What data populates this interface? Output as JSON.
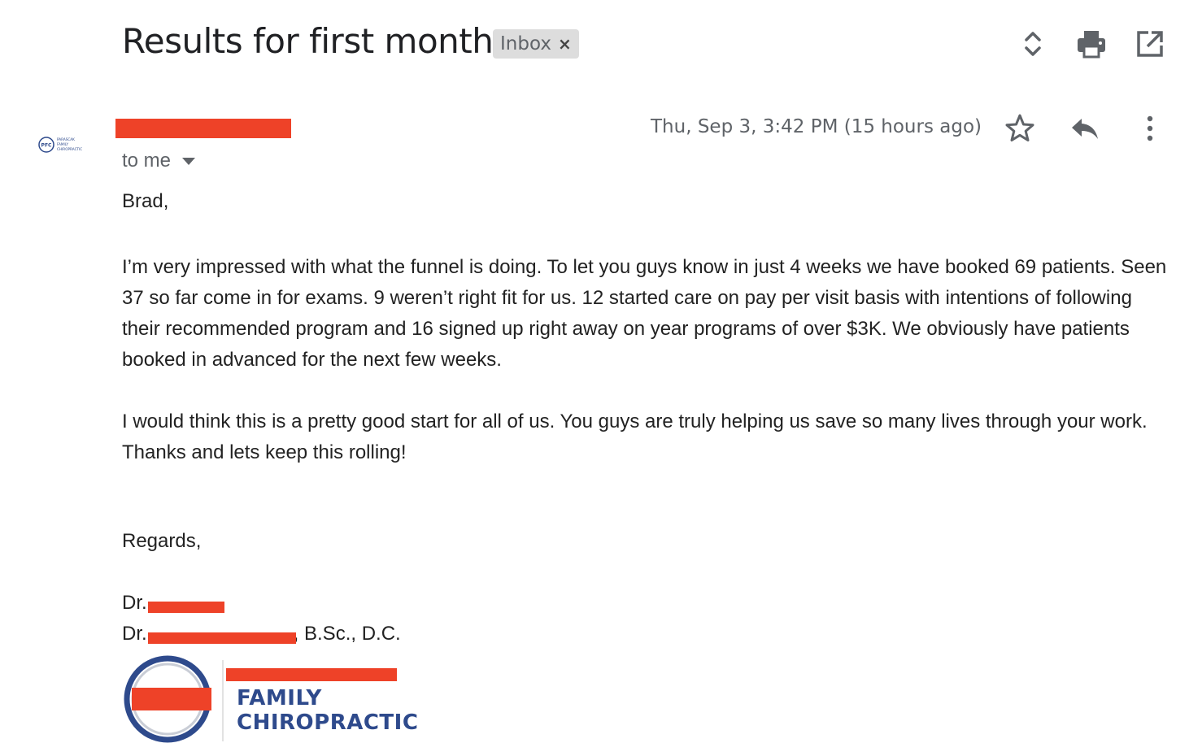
{
  "header": {
    "subject": "Results for first month",
    "label": "Inbox",
    "label_remove": "×",
    "icons": [
      "expand-collapse-icon",
      "print-icon",
      "open-in-new-window-icon"
    ]
  },
  "message": {
    "sender_name": "[redacted]",
    "avatar_initials": "PFC",
    "avatar_text": [
      "PARASCAK",
      "FAMILY",
      "CHIROPRACTIC"
    ],
    "recipient": "to me",
    "date": "Thu, Sep 3, 3:42 PM (15 hours ago)",
    "actions": [
      "star-icon",
      "reply-icon",
      "more-options-icon"
    ]
  },
  "body": {
    "greeting": "Brad,",
    "paragraph1": "I’m very impressed with what the funnel is doing. To let you guys know in just 4 weeks we have booked 69 patients. Seen 37 so far come in for exams. 9 weren’t right fit for us. 12 started care on pay per visit basis with intentions of following their recommended program and 16 signed up right away on year programs of over $3K. We obviously have patients booked in advanced for the next few weeks.",
    "paragraph2": "I would think this is a pretty good start for all of us. You guys are truly helping us save so many lives through your work. Thanks and lets keep this rolling!",
    "closing": "Regards,"
  },
  "signature": {
    "line1_prefix": "Dr.",
    "line2_prefix": "Dr.",
    "line2_suffix": ", B.Sc., D.C.",
    "logo_lines": [
      "FAMILY",
      "CHIROPRACTIC"
    ]
  },
  "colors": {
    "redaction": "#ee4228",
    "logo_blue": "#2e4a8c",
    "text": "#222222",
    "muted": "#5f6368"
  }
}
